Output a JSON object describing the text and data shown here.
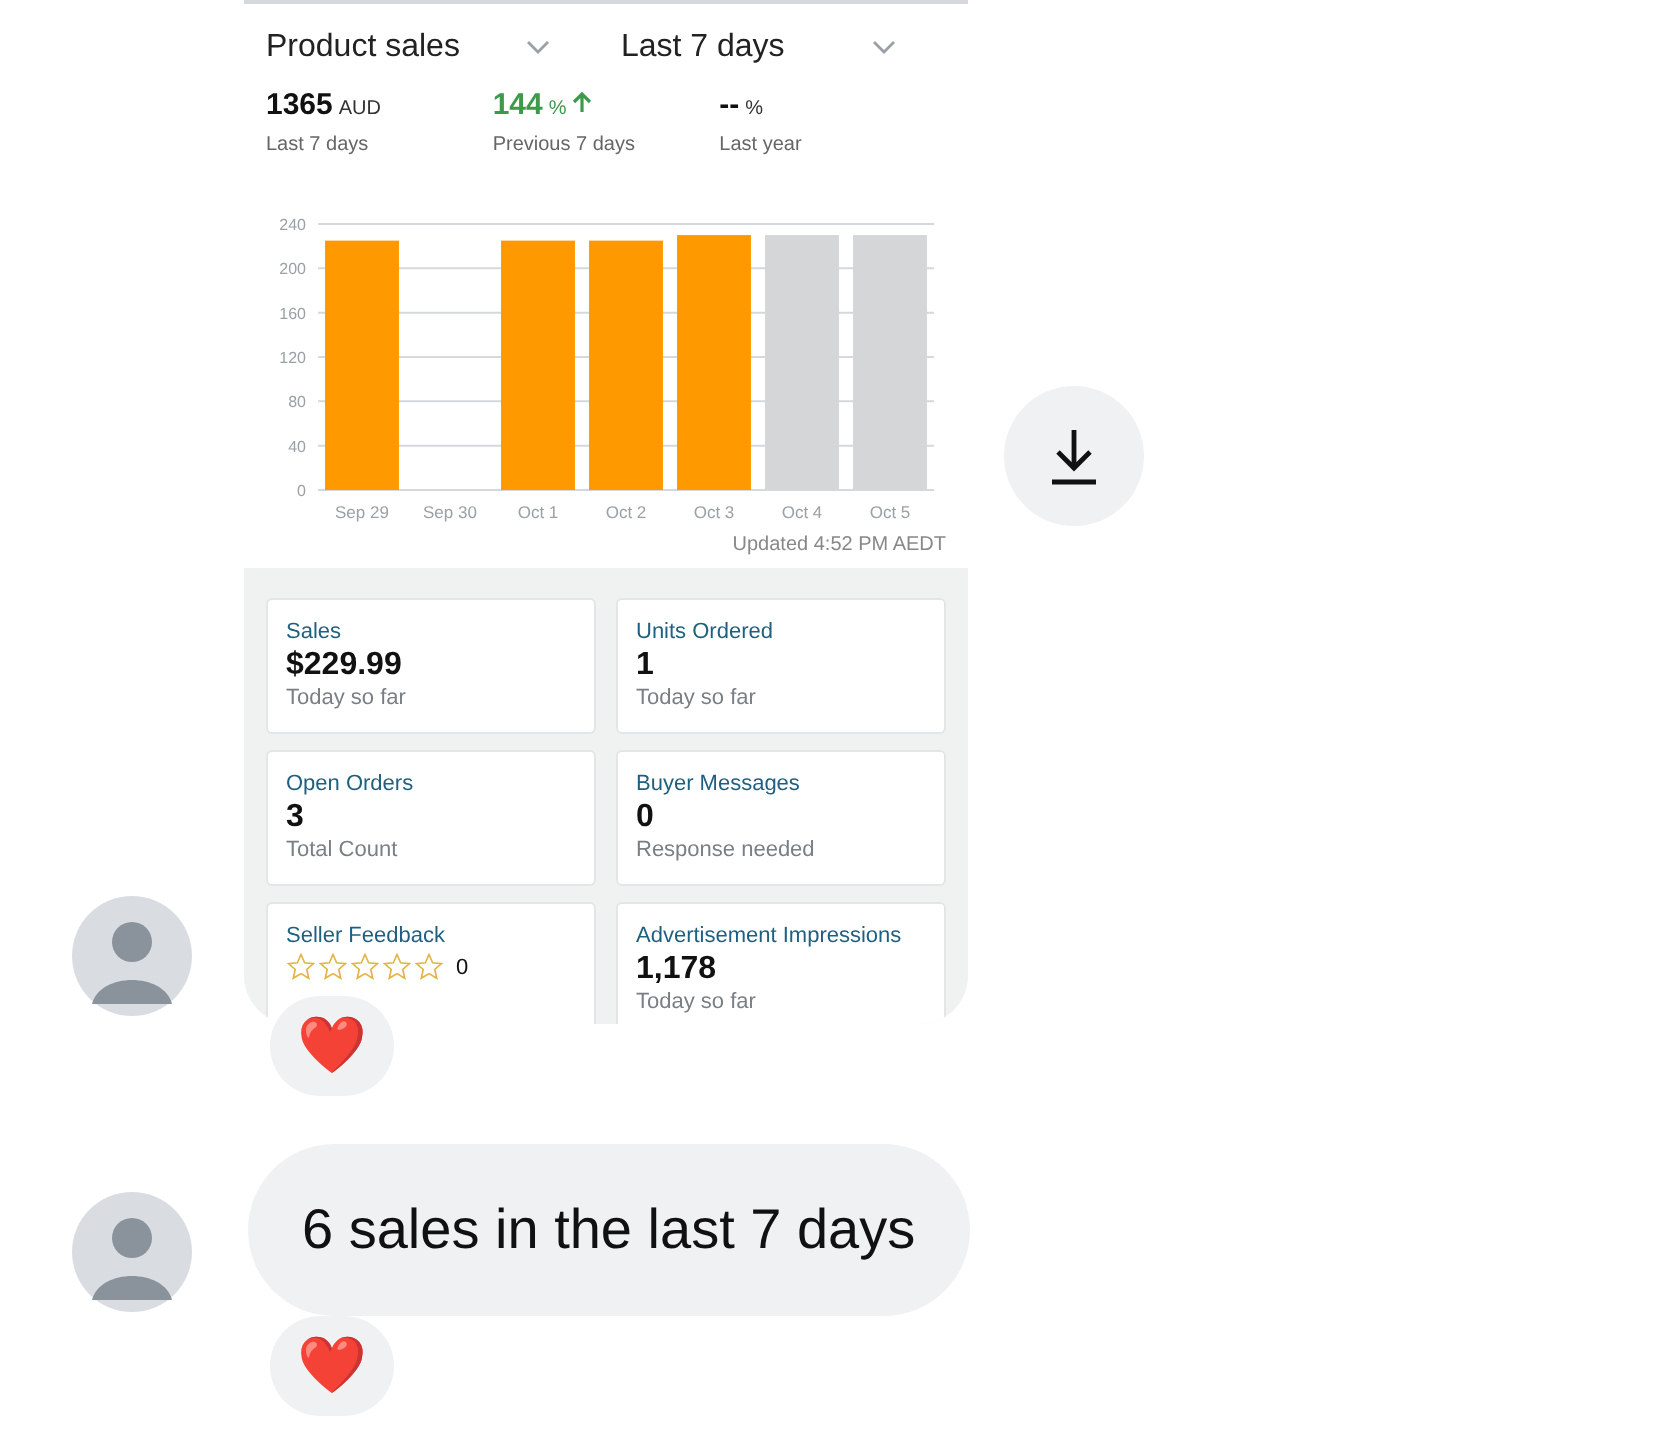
{
  "shared_screenshot": {
    "metric_dropdown": {
      "value": "Product sales"
    },
    "period_dropdown": {
      "value": "Last 7 days"
    },
    "summary": [
      {
        "value": "1365",
        "unit": "AUD",
        "label": "Last 7 days",
        "kind": "plain"
      },
      {
        "value": "144",
        "unit": "%",
        "label": "Previous 7 days",
        "kind": "up"
      },
      {
        "value": "--",
        "unit": "%",
        "label": "Last year",
        "kind": "plain"
      }
    ],
    "chart_data": {
      "type": "bar",
      "categories": [
        "Sep 29",
        "Sep 30",
        "Oct 1",
        "Oct 2",
        "Oct 3",
        "Oct 4",
        "Oct 5"
      ],
      "grid": true,
      "ylim": [
        0,
        240
      ],
      "yticks": [
        0,
        40,
        80,
        120,
        160,
        200,
        240
      ],
      "series": [
        {
          "color": "#ff9900",
          "values": [
            225,
            0,
            225,
            225,
            230,
            null,
            null
          ]
        },
        {
          "color": "#d5d6d8",
          "values": [
            null,
            null,
            null,
            null,
            null,
            230,
            230
          ]
        }
      ]
    },
    "updated": "Updated 4:52 PM AEDT",
    "cards": [
      {
        "title": "Sales",
        "value": "$229.99",
        "note": "Today so far",
        "kind": "value"
      },
      {
        "title": "Units Ordered",
        "value": "1",
        "note": "Today so far",
        "kind": "value"
      },
      {
        "title": "Open Orders",
        "value": "3",
        "note": "Total Count",
        "kind": "value"
      },
      {
        "title": "Buyer Messages",
        "value": "0",
        "note": "Response needed",
        "kind": "value"
      },
      {
        "title": "Seller Feedback",
        "stars": 0,
        "count": "0",
        "kind": "rating"
      },
      {
        "title": "Advertisement Impressions",
        "value": "1,178",
        "note": "Today so far",
        "kind": "value"
      }
    ]
  },
  "messages": [
    {
      "kind": "image",
      "reaction": "❤️"
    },
    {
      "kind": "text",
      "text": "6 sales in the last 7 days",
      "reaction": "❤️"
    }
  ]
}
